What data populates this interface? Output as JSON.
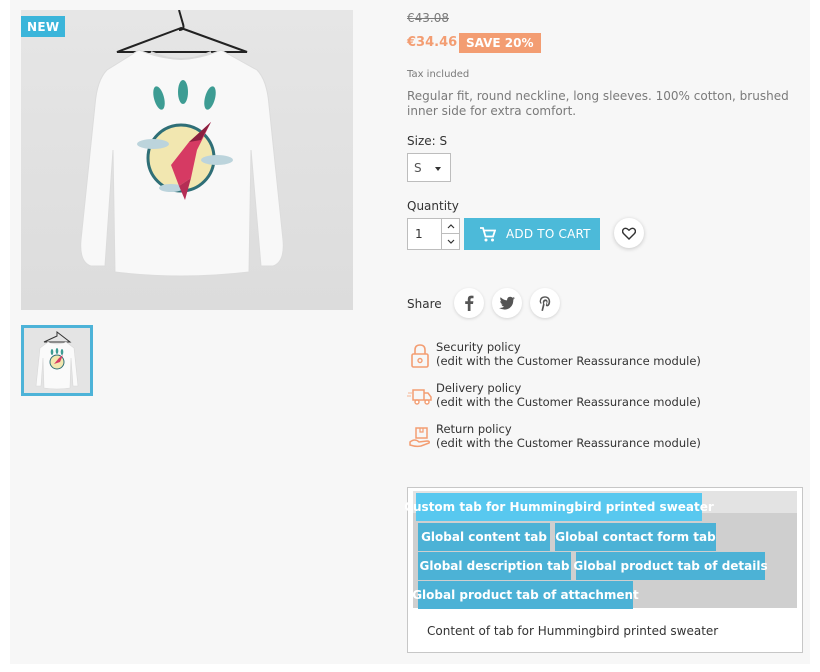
{
  "product": {
    "badge_new": "NEW",
    "old_price": "€43.08",
    "price": "€34.46",
    "save_badge": "SAVE 20%",
    "tax_note": "Tax included",
    "description": "Regular fit, round neckline, long sleeves. 100% cotton, brushed inner side for extra comfort.",
    "size_label": "Size: S",
    "size_value": "S",
    "quantity_label": "Quantity",
    "quantity_value": "1",
    "add_to_cart": "ADD TO CART",
    "share_label": "Share"
  },
  "icons": {
    "wishlist": "heart-icon",
    "cart": "cart-icon",
    "share": [
      "facebook-icon",
      "twitter-icon",
      "pinterest-icon"
    ],
    "reassurance": [
      "lock-icon",
      "truck-icon",
      "return-box-icon"
    ]
  },
  "reassurance": [
    {
      "title": "Security policy",
      "subtitle": "(edit with the Customer Reassurance module)"
    },
    {
      "title": "Delivery policy",
      "subtitle": "(edit with the Customer Reassurance module)"
    },
    {
      "title": "Return policy",
      "subtitle": "(edit with the Customer Reassurance module)"
    }
  ],
  "tabs": {
    "items": [
      "Custom tab for Hummingbird printed sweater",
      "Global content tab",
      "Global contact form tab",
      "Global description tab",
      "Global product tab of details",
      "Global product tab of attachment"
    ],
    "active_index": 0,
    "content": "Content of tab for Hummingbird printed sweater"
  },
  "colors": {
    "accent": "#4cbad9",
    "active_tab": "#58c8ef",
    "sale": "#f39d72",
    "new_badge": "#3bb5da"
  }
}
